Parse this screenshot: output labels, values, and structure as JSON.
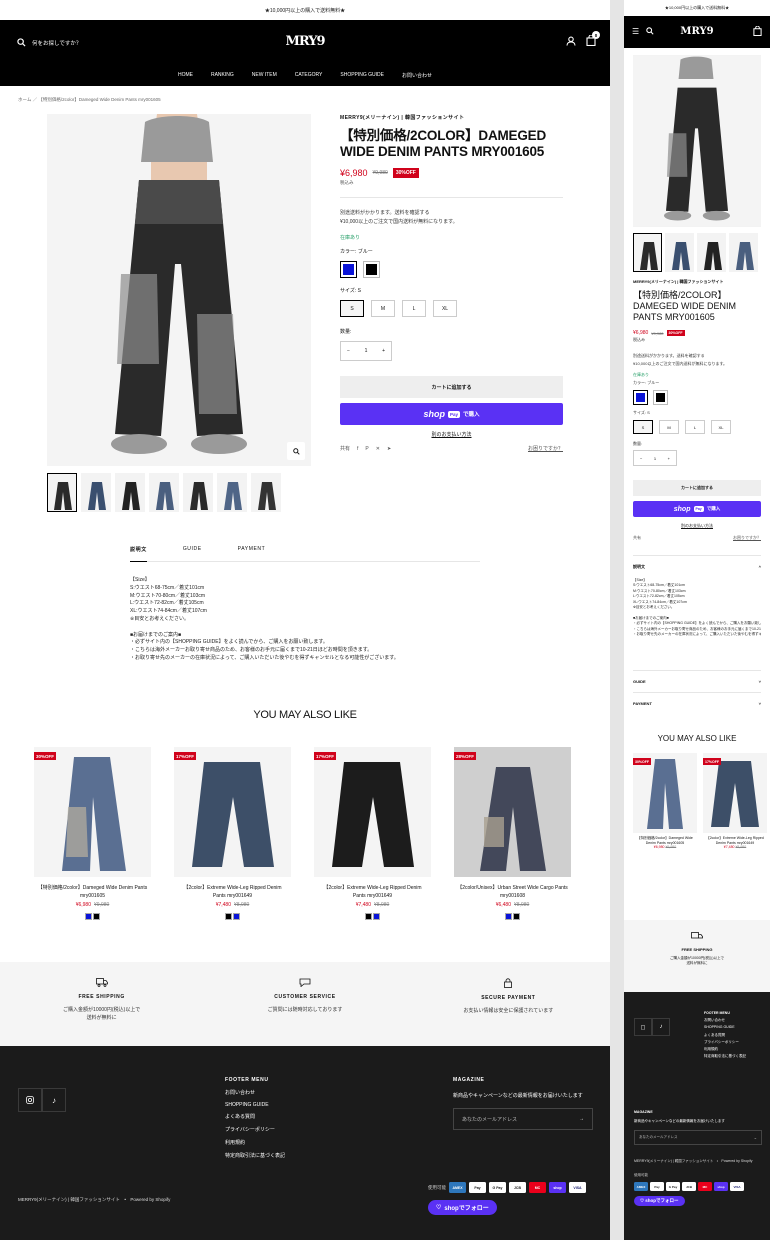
{
  "announcement": "★10,000円以上の購入で送料無料★",
  "brand": "MRY9",
  "search": {
    "placeholder": "何をお探しですか？"
  },
  "cart_count": "0",
  "nav": [
    "HOME",
    "RANKING",
    "NEW ITEM",
    "CATEGORY",
    "SHOPPING GUIDE",
    "お問い合わせ"
  ],
  "breadcrumb": "ホーム ／ 【特別価格/2color】Dameged Wide Denim Pants mry001605",
  "product": {
    "vendor": "MERRY9(メリーナイン) | 韓国ファッションサイト",
    "title": "【特別価格/2COLOR】DAMEGED WIDE DENIM PANTS MRY001605",
    "price": "¥6,980",
    "compare_price": "¥9,980",
    "discount": "30%OFF",
    "tax_note": "税込み",
    "shipping_note": "別途送料がかかります。送料を確認する",
    "free_ship_note": "¥10,000以上のご注文で国内送料が無料になります。",
    "stock": "在庫あり",
    "color_label": "カラー:  ブルー",
    "colors": [
      "#0a14d8",
      "#000000"
    ],
    "size_label": "サイズ:  S",
    "sizes": [
      "S",
      "M",
      "L",
      "XL"
    ],
    "qty_label": "数量:",
    "qty": "1",
    "add_to_cart": "カートに追加する",
    "shop_pay_word": "shop",
    "shop_pay_pill": "Pay",
    "shop_pay_suffix": "で購入",
    "more_payment": "別のお支払い方法",
    "share_label": "共有",
    "help_link": "お困りですか？"
  },
  "tabs": [
    "説明文",
    "GUIDE",
    "PAYMENT"
  ],
  "description": "【Size】\nS:ウエスト68-75cm／着丈101cm\nM:ウエスト70-80cm／着丈103cm\nL:ウエスト72-82cm／着丈105cm\nXL:ウエスト74-84cm／着丈107cm\n※目安とお考えください。\n\n■お届けまでのご案内■\n・必ずサイト内の【SHOPPING GUIDE】をよく読んでから、ご購入をお願い致します。\n・こちらは海外メーカーお取り寄せ商品のため、お客様のお手元に届くまで10-21日ほどお時間を頂きます。\n・お取り寄せ先のメーカーの在庫状況によって、ご購入いただいた後やむを得ずキャンセルとなる可能性がございます。",
  "ymal_title": "YOU MAY ALSO LIKE",
  "related": [
    {
      "badge": "30%OFF",
      "name": "【特別価格/2color】Dameged Wide Denim Pants mry001605",
      "price": "¥6,980",
      "compare": "¥9,980",
      "swatches": [
        "#0a14d8",
        "#000000"
      ]
    },
    {
      "badge": "17%OFF",
      "name": "【2color】Extreme Wide-Leg Ripped Denim Pants mry001649",
      "price": "¥7,480",
      "compare": "¥8,980",
      "swatches": [
        "#000000",
        "#0a14d8"
      ]
    },
    {
      "badge": "17%OFF",
      "name": "【2color】Extreme Wide-Leg Ripped Denim Pants mry001649",
      "price": "¥7,480",
      "compare": "¥8,980",
      "swatches": [
        "#000000",
        "#0a14d8"
      ]
    },
    {
      "badge": "28%OFF",
      "name": "【2color/Unisex】Urban Street Wide Cargo Pants mry001608",
      "price": "¥6,480",
      "compare": "¥8,980",
      "swatches": [
        "#0a14d8",
        "#000000"
      ]
    }
  ],
  "features": [
    {
      "icon": "truck-icon",
      "title": "FREE SHIPPING",
      "desc": "ご購入金額が10000円(税込)以上で\n送料が無料に"
    },
    {
      "icon": "chat-icon",
      "title": "CUSTOMER SERVICE",
      "desc": "ご質問には随時対応しております"
    },
    {
      "icon": "lock-icon",
      "title": "SECURE PAYMENT",
      "desc": "お支払い情報は安全に保護されています"
    }
  ],
  "footer": {
    "menu_title": "FOOTER MENU",
    "menu": [
      "お問い合わせ",
      "SHOPPING GUIDE",
      "よくある質問",
      "プライバシーポリシー",
      "利用規約",
      "特定商取引法に基づく表記"
    ],
    "mag_title": "MAGAZINE",
    "mag_text": "新商品やキャンペーンなどの最新情報をお届けいたします",
    "email_placeholder": "あなたのメールアドレス",
    "copyright": "MERRY9(メリーナイン) | 韓国ファッションサイト　•　Powered by Shopify",
    "pay_label": "使用可能",
    "pay_methods": [
      "AMEX",
      "Pay",
      "G Pay",
      "JCB",
      "MC",
      "shop",
      "VISA"
    ],
    "follow": "shopでフォロー"
  },
  "mobile": {
    "accordions": [
      "説明文",
      "GUIDE",
      "PAYMENT"
    ],
    "mobile_follow": "shopでフォロー"
  }
}
